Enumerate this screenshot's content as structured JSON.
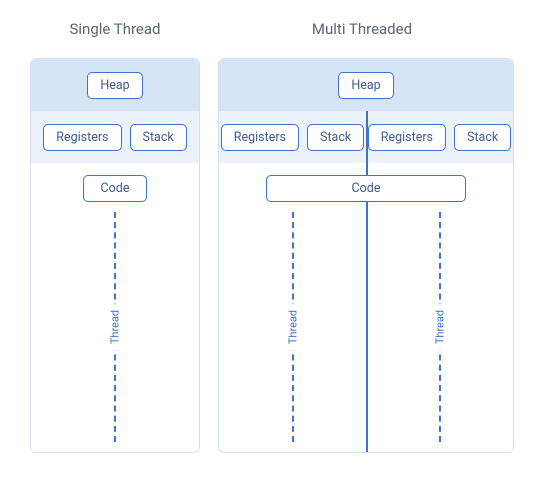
{
  "titles": {
    "single": "Single Thread",
    "multi": "Multi Threaded"
  },
  "labels": {
    "heap": "Heap",
    "registers": "Registers",
    "stack": "Stack",
    "code": "Code",
    "thread": "Thread"
  },
  "diagram": {
    "single": {
      "thread_count": 1
    },
    "multi": {
      "thread_count": 2
    }
  },
  "colors": {
    "border": "#3f72c8",
    "heap_band": "#d5e5f5",
    "reg_band": "#ecf2f9"
  }
}
